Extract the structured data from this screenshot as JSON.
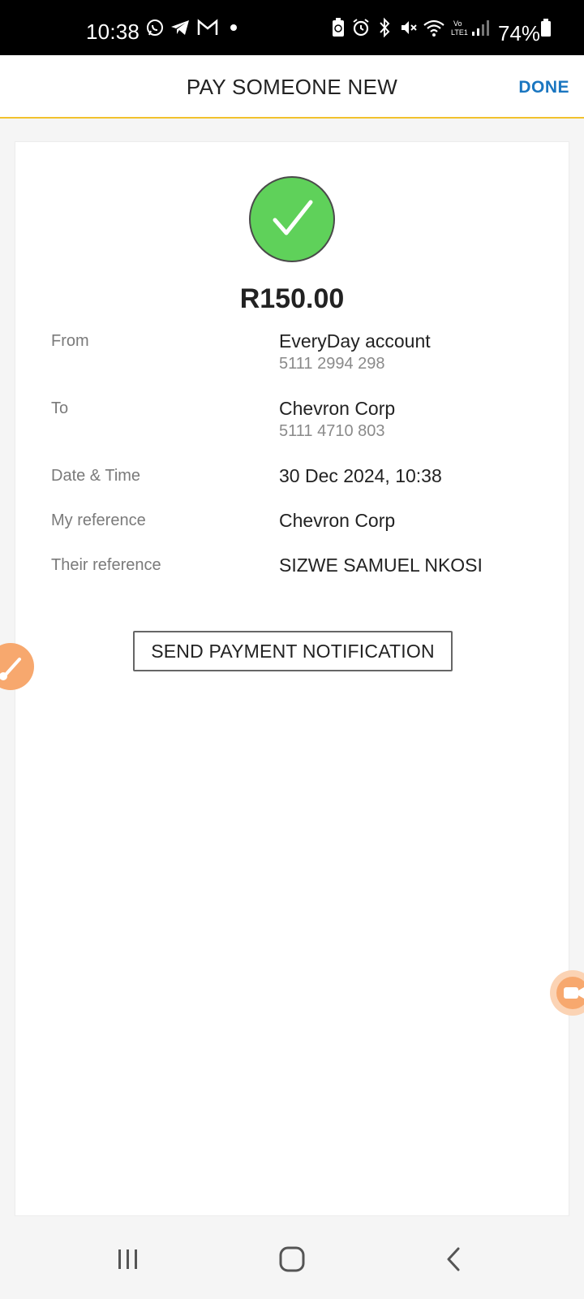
{
  "status_bar": {
    "time": "10:38",
    "battery_percent": "74%",
    "icons": [
      "whatsapp-icon",
      "telegram-icon",
      "gmail-icon",
      "dot-icon",
      "battery-saver-icon",
      "alarm-icon",
      "bluetooth-icon",
      "mute-icon",
      "wifi-icon",
      "volte-icon",
      "signal-icon",
      "battery-icon"
    ]
  },
  "header": {
    "title": "PAY SOMEONE NEW",
    "done_label": "DONE",
    "accent_color": "#f2c22d",
    "link_color": "#1a76c0"
  },
  "receipt": {
    "status_icon": "check-icon",
    "success_color": "#5fd15a",
    "amount": "R150.00",
    "from": {
      "label": "From",
      "value": "EveryDay account",
      "account_number": "5111 2994 298"
    },
    "to": {
      "label": "To",
      "value": "Chevron Corp",
      "account_number": "5111 4710 803"
    },
    "date_time": {
      "label": "Date & Time",
      "value": "30 Dec 2024, 10:38"
    },
    "my_reference": {
      "label": "My reference",
      "value": "Chevron Corp"
    },
    "their_reference": {
      "label": "Their reference",
      "value": "SIZWE SAMUEL NKOSI"
    },
    "notify_button_label": "SEND PAYMENT NOTIFICATION"
  },
  "floating": {
    "left_icon": "brush-icon",
    "right_icon": "video-icon",
    "color": "#f7a86e"
  },
  "nav_bar": {
    "buttons": [
      "recent-apps-icon",
      "home-icon",
      "back-icon"
    ]
  }
}
